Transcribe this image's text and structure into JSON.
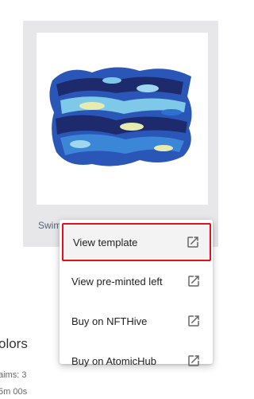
{
  "card": {
    "title": "Swim",
    "image_name": "swimming-fish-painting"
  },
  "section": {
    "title": "olors",
    "meta_line_1": "aims: 3",
    "meta_line_2": "5m 00s"
  },
  "menu": {
    "items": [
      {
        "label": "View template",
        "icon": "external-link-icon",
        "highlighted": true
      },
      {
        "label": "View pre-minted left",
        "icon": "external-link-icon"
      },
      {
        "label": "Buy on NFTHive",
        "icon": "external-link-icon"
      },
      {
        "label": "Buy on AtomicHub",
        "icon": "external-link-icon"
      }
    ]
  },
  "colors": {
    "highlight_border": "#e0111e",
    "card_bg": "#e7e7e9",
    "fish_dark": "#1d2a6b",
    "fish_mid": "#2f6fd0",
    "fish_light": "#7fc9e8",
    "fish_yellow": "#e6ecb0"
  }
}
